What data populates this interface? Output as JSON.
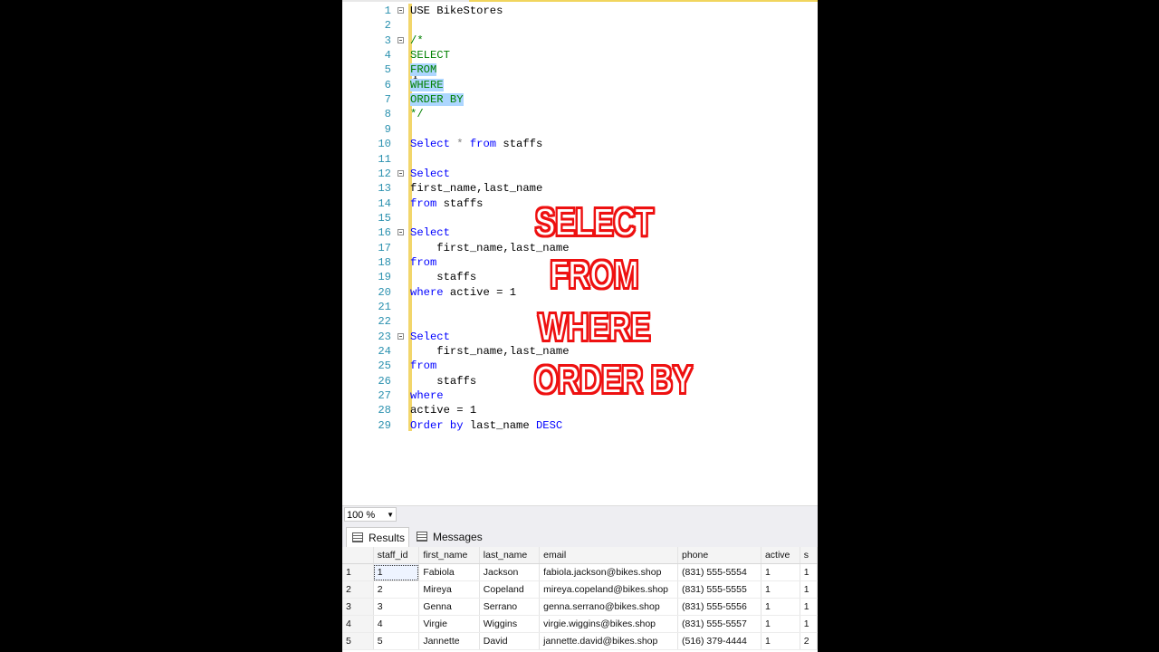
{
  "editor": {
    "lines": [
      [
        {
          "t": "USE BikeStores",
          "c": ""
        }
      ],
      [],
      [
        {
          "t": "/*",
          "c": "cm"
        }
      ],
      [
        {
          "t": "SELECT",
          "c": "cm"
        }
      ],
      [
        {
          "t": "FROM",
          "c": "cm sel"
        }
      ],
      [
        {
          "t": "WHERE",
          "c": "cm sel"
        }
      ],
      [
        {
          "t": "ORDER BY",
          "c": "cm sel"
        }
      ],
      [
        {
          "t": "*/",
          "c": "cm"
        }
      ],
      [],
      [
        {
          "t": "Select",
          "c": "kw"
        },
        {
          "t": " * ",
          "c": "gr"
        },
        {
          "t": "from",
          "c": "kw"
        },
        {
          "t": " staffs",
          "c": ""
        }
      ],
      [],
      [
        {
          "t": "Select",
          "c": "kw"
        }
      ],
      [
        {
          "t": "first_name,last_name",
          "c": ""
        }
      ],
      [
        {
          "t": "from",
          "c": "kw"
        },
        {
          "t": " staffs",
          "c": ""
        }
      ],
      [],
      [
        {
          "t": "Select",
          "c": "kw"
        }
      ],
      [
        {
          "t": "    first_name,last_name",
          "c": ""
        }
      ],
      [
        {
          "t": "from",
          "c": "kw"
        }
      ],
      [
        {
          "t": "    staffs",
          "c": ""
        }
      ],
      [
        {
          "t": "where",
          "c": "kw"
        },
        {
          "t": " active = 1",
          "c": ""
        }
      ],
      [],
      [],
      [
        {
          "t": "Select",
          "c": "kw"
        }
      ],
      [
        {
          "t": "    first_name,last_name",
          "c": ""
        }
      ],
      [
        {
          "t": "from",
          "c": "kw"
        }
      ],
      [
        {
          "t": "    staffs",
          "c": ""
        }
      ],
      [
        {
          "t": "where",
          "c": "kw"
        }
      ],
      [
        {
          "t": "active = 1",
          "c": ""
        }
      ],
      [
        {
          "t": "Order by",
          "c": "kw"
        },
        {
          "t": " last_name ",
          "c": ""
        },
        {
          "t": "DESC",
          "c": "kw"
        }
      ]
    ],
    "fold_lines": [
      1,
      3,
      12,
      16,
      23
    ]
  },
  "overlay": {
    "lines": [
      "SELECT",
      "FROM",
      "WHERE",
      "ORDER BY"
    ],
    "color": "#e11111"
  },
  "zoom": {
    "value": "100 %"
  },
  "tabs": {
    "results": "Results",
    "messages": "Messages"
  },
  "results": {
    "columns": [
      "staff_id",
      "first_name",
      "last_name",
      "email",
      "phone",
      "active",
      "s"
    ],
    "rows": [
      [
        "1",
        "1",
        "Fabiola",
        "Jackson",
        "fabiola.jackson@bikes.shop",
        "(831) 555-5554",
        "1",
        "1"
      ],
      [
        "2",
        "2",
        "Mireya",
        "Copeland",
        "mireya.copeland@bikes.shop",
        "(831) 555-5555",
        "1",
        "1"
      ],
      [
        "3",
        "3",
        "Genna",
        "Serrano",
        "genna.serrano@bikes.shop",
        "(831) 555-5556",
        "1",
        "1"
      ],
      [
        "4",
        "4",
        "Virgie",
        "Wiggins",
        "virgie.wiggins@bikes.shop",
        "(831) 555-5557",
        "1",
        "1"
      ],
      [
        "5",
        "5",
        "Jannette",
        "David",
        "jannette.david@bikes.shop",
        "(516) 379-4444",
        "1",
        "2"
      ]
    ]
  }
}
